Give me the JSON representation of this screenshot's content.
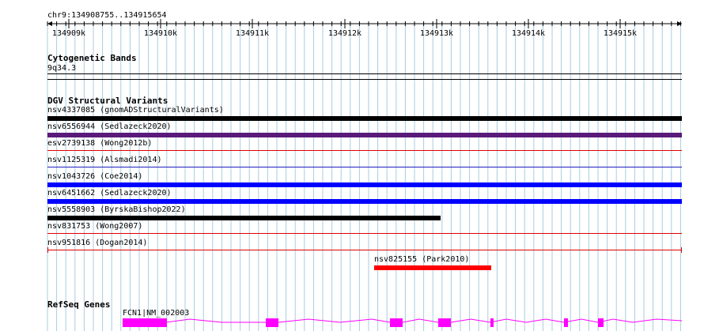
{
  "location": "chr9:134908755..134915654",
  "ruler": {
    "ticks": [
      "134909k",
      "134910k",
      "134911k",
      "134912k",
      "134913k",
      "134914k",
      "134915k"
    ]
  },
  "cytoband": {
    "title": "Cytogenetic Bands",
    "band": "9q34.3"
  },
  "dgv": {
    "title": "DGV Structural Variants",
    "variants": [
      {
        "label": "nsv4337085 (gnomADStructuralVariants)",
        "color": "#000000",
        "style": "thick"
      },
      {
        "label": "nsv6556944 (Sedlazeck2020)",
        "color": "#5a1a7a",
        "style": "thick"
      },
      {
        "label": "esv2739138 (Wong2012b)",
        "color": "#e00000",
        "style": "thin"
      },
      {
        "label": "nsv1125319 (Alsmadi2014)",
        "color": "#2020c0",
        "style": "thin"
      },
      {
        "label": "nsv1043726 (Coe2014)",
        "color": "#0000ff",
        "style": "thick"
      },
      {
        "label": "nsv6451662 (Sedlazeck2020)",
        "color": "#0000ff",
        "style": "thick"
      },
      {
        "label": "nsv5558903 (ByrskaBishop2022)",
        "color": "#000000",
        "style": "thick-partial"
      },
      {
        "label": "nsv831753 (Wong2007)",
        "color": "#e00000",
        "style": "thin"
      },
      {
        "label": "nsv951816 (Dogan2014)",
        "color": "#e00000",
        "style": "thin-capped"
      },
      {
        "label": "nsv825155 (Park2010)",
        "color": "#ff0000",
        "style": "thick-short"
      }
    ]
  },
  "refseq": {
    "title": "RefSeq Genes",
    "gene_label": "FCN1|NM_002003",
    "color": "#ff00ff"
  },
  "colors": {
    "grid": "#a8cde0",
    "gene": "#ff00ff"
  }
}
